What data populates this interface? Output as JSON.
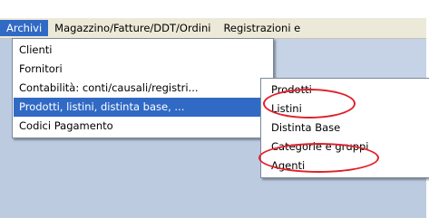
{
  "menubar": {
    "items": [
      {
        "label": "Archivi"
      },
      {
        "label": "Magazzino/Fatture/DDT/Ordini"
      },
      {
        "label": "Registrazioni e"
      }
    ]
  },
  "archivi_menu": {
    "items": [
      {
        "label": "Clienti"
      },
      {
        "label": "Fornitori"
      },
      {
        "label": "Contabilità: conti/causali/registri..."
      },
      {
        "label": "Prodotti, listini, distinta base, ..."
      },
      {
        "label": "Codici Pagamento"
      }
    ]
  },
  "prodotti_submenu": {
    "items": [
      {
        "label": "Prodotti"
      },
      {
        "label": "Listini"
      },
      {
        "label": "Distinta Base"
      },
      {
        "label": "Categorie e gruppi"
      },
      {
        "label": "Agenti"
      }
    ]
  },
  "colors": {
    "highlight": "#316ac5",
    "annotation": "#e0202a",
    "workspace": "#bccbe0"
  }
}
